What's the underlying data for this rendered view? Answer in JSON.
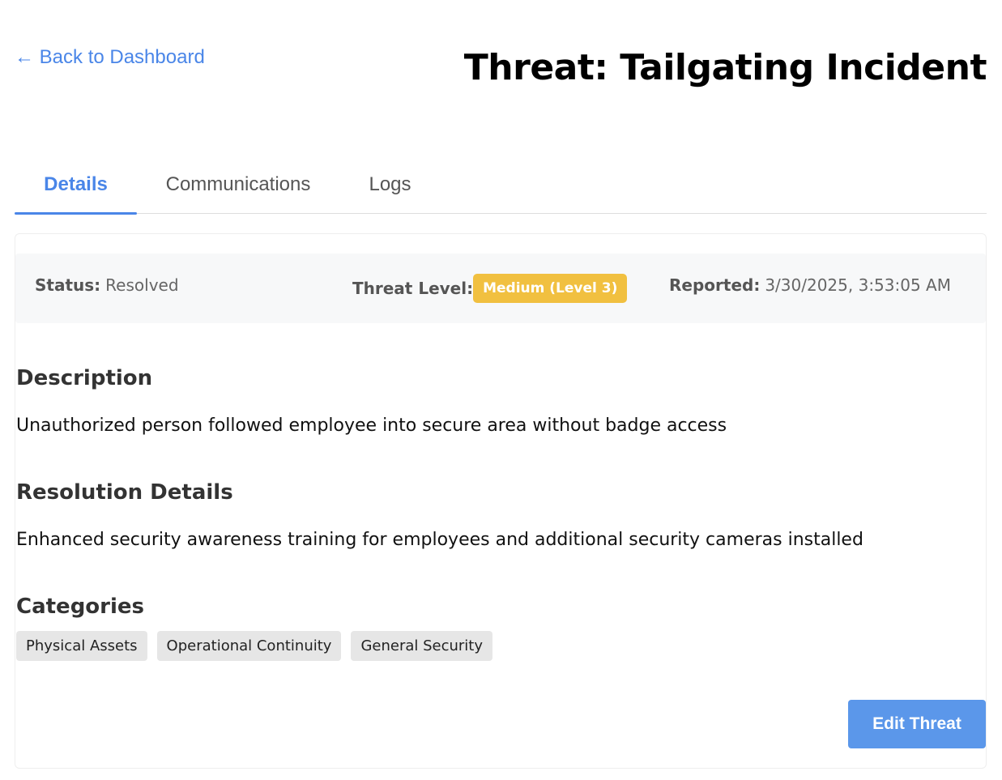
{
  "header": {
    "back_label": "← Back to Dashboard",
    "title": "Threat: Tailgating Incident"
  },
  "tabs": [
    {
      "label": "Details",
      "active": true
    },
    {
      "label": "Communications",
      "active": false
    },
    {
      "label": "Logs",
      "active": false
    }
  ],
  "summary": {
    "status_label": "Status:",
    "status_value": "Resolved",
    "level_label": "Threat Level:",
    "level_value": "Medium (Level 3)",
    "reported_label": "Reported:",
    "reported_value": "3/30/2025, 3:53:05 AM"
  },
  "description": {
    "heading": "Description",
    "text": "Unauthorized person followed employee into secure area without badge access"
  },
  "resolution": {
    "heading": "Resolution Details",
    "text": "Enhanced security awareness training for employees and additional security cameras installed"
  },
  "categories": {
    "heading": "Categories",
    "items": [
      "Physical Assets",
      "Operational Continuity",
      "General Security"
    ]
  },
  "actions": {
    "edit_label": "Edit Threat"
  },
  "colors": {
    "accent": "#4a86e8",
    "level_badge": "#f1c040",
    "button": "#5b97ea"
  }
}
